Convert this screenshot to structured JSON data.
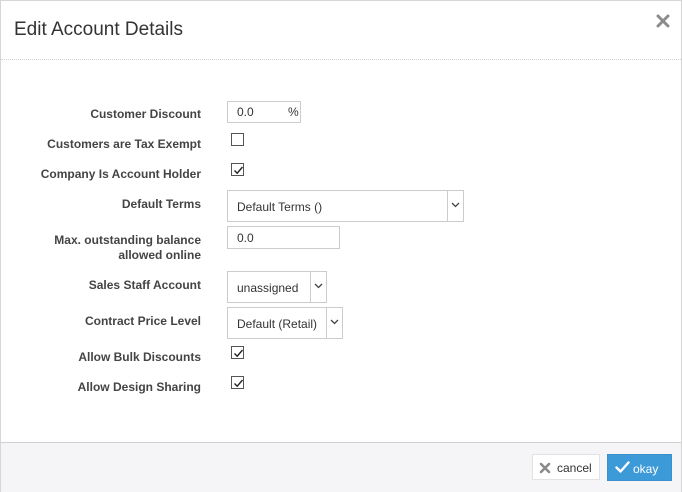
{
  "dialog": {
    "title": "Edit Account Details",
    "close_icon": "close-icon"
  },
  "form": {
    "customer_discount": {
      "label": "Customer Discount",
      "value": "0.0",
      "suffix": "%"
    },
    "tax_exempt": {
      "label": "Customers are Tax Exempt",
      "checked": false
    },
    "company_account_holder": {
      "label": "Company Is Account Holder",
      "checked": true
    },
    "default_terms": {
      "label": "Default Terms",
      "value": "Default Terms ()"
    },
    "max_outstanding": {
      "label_line1": "Max. outstanding balance",
      "label_line2": "allowed online",
      "value": "0.0"
    },
    "sales_staff": {
      "label": "Sales Staff Account",
      "value": "unassigned"
    },
    "contract_price": {
      "label": "Contract Price Level",
      "value": "Default (Retail)"
    },
    "bulk_discounts": {
      "label": "Allow Bulk Discounts",
      "checked": true
    },
    "design_sharing": {
      "label": "Allow Design Sharing",
      "checked": true
    }
  },
  "footer": {
    "cancel_label": "cancel",
    "okay_label": "okay"
  },
  "colors": {
    "primary": "#3d9ad8",
    "footer_bg": "#f5f5f7"
  }
}
